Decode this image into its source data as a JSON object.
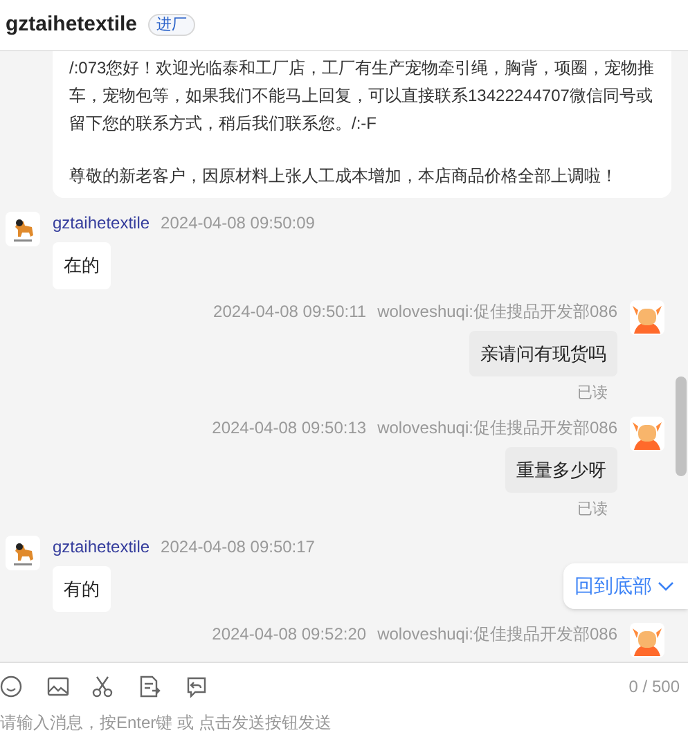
{
  "header": {
    "title": "gztaihetextile",
    "badge": "进厂"
  },
  "notice": {
    "lines": [
      "/:073您好！欢迎光临泰和工厂店，工厂有生产宠物牵引绳，胸背，项圈，宠物推车，宠物包等，如果我们不能马上回复，可以直接联系13422244707微信同号或留下您的联系方式，稍后我们联系您。/:-F",
      "尊敬的新老客户，因原材料上张人工成本增加，本店商品价格全部上调啦！"
    ]
  },
  "messages": [
    {
      "kind": "incoming",
      "sender": "gztaihetextile",
      "time": "2024-04-08 09:50:09",
      "text": "在的"
    },
    {
      "kind": "outgoing",
      "sender": "woloveshuqi:促佳搜品开发部086",
      "time": "2024-04-08 09:50:11",
      "text": "亲请问有现货吗",
      "status": "已读"
    },
    {
      "kind": "outgoing",
      "sender": "woloveshuqi:促佳搜品开发部086",
      "time": "2024-04-08 09:50:13",
      "text": "重量多少呀",
      "status": "已读"
    },
    {
      "kind": "incoming",
      "sender": "gztaihetextile",
      "time": "2024-04-08 09:50:17",
      "text": "有的"
    },
    {
      "kind": "outgoing",
      "sender": "woloveshuqi:促佳搜品开发部086",
      "time": "2024-04-08 09:52:20"
    }
  ],
  "back_to_bottom": "回到底部",
  "composer": {
    "counter": "0 / 500",
    "placeholder": "请输入消息，按Enter键 或 点击发送按钮发送"
  }
}
